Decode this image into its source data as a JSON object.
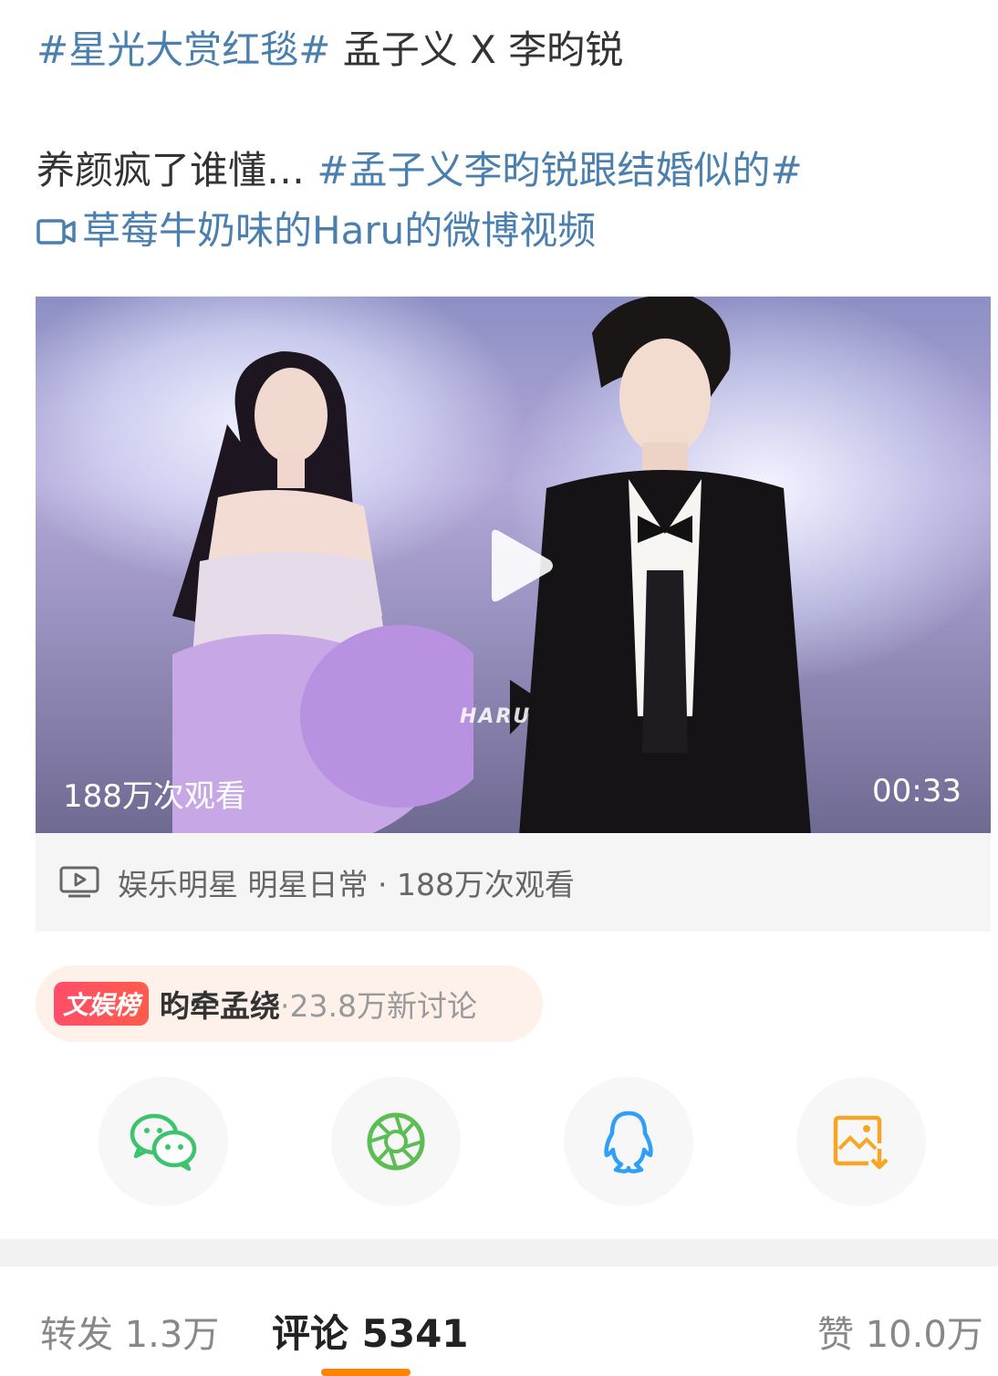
{
  "post": {
    "line1_tag": "#星光大赏红毯#",
    "line1_text": " 孟子义 X 李昀锐",
    "line2_text": "养颜疯了谁懂… ",
    "line2_tag": "#孟子义李昀锐跟结婚似的#",
    "video_link": "草莓牛奶味的Haru的微博视频"
  },
  "video": {
    "views": "188万次观看",
    "duration": "00:33",
    "watermark": "HARU",
    "meta": "娱乐明星 明星日常 · 188万次观看"
  },
  "trend": {
    "badge": "文娱榜",
    "name": "昀牵孟绕",
    "stat": "·23.8万新讨论"
  },
  "share": {
    "icons": [
      "wechat-icon",
      "moments-icon",
      "qq-icon",
      "save-image-icon"
    ],
    "colors": {
      "wechat": "#3dc36e",
      "moments": "#5bbd52",
      "qq": "#2f9ff8",
      "save": "#f5a623"
    }
  },
  "tabs": {
    "repost": "转发 1.3万",
    "comment": "评论 5341",
    "like": "赞 10.0万",
    "accent": "#ff8200"
  }
}
